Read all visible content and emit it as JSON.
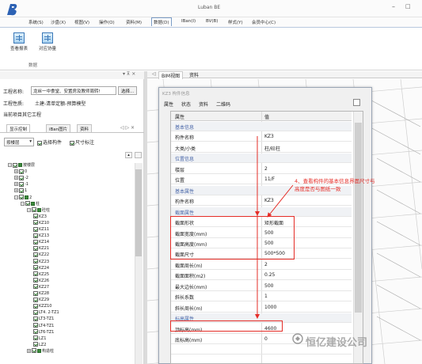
{
  "app": {
    "title": "Luban BE",
    "min_glyph": "–",
    "max_glyph": "□"
  },
  "menu": [
    {
      "label": "系统(S)"
    },
    {
      "label": "沙盘(X)"
    },
    {
      "label": "视图(V)"
    },
    {
      "label": "操作(O)"
    },
    {
      "label": "资料(M)"
    },
    {
      "label": "数据(D)",
      "active": true
    },
    {
      "label": "IBan(I)"
    },
    {
      "label": "BV(B)"
    },
    {
      "label": "样式(Y)"
    },
    {
      "label": "会员中心(C)"
    }
  ],
  "ribbon": {
    "buttons": [
      {
        "label": "查看报表"
      },
      {
        "label": "对应协量"
      }
    ],
    "group_label": "数据"
  },
  "left_panel": {
    "controls": "▾ ⊼ ×",
    "project_name_label": "工程名称:",
    "project_name_value": "龙丝一中食堂、安置房及教师周转!",
    "select_button": "选择...",
    "project_type_label": "工程性质:",
    "project_type_value": "土建-清单定额-预算模型",
    "current_project": "当前项目其它工程",
    "tabs": [
      {
        "label": "显示控制",
        "active": true
      },
      {
        "label": "iBan图片"
      },
      {
        "label": "资料"
      }
    ],
    "tab_nav": "◁ ▷ ×",
    "mode_select": "按楼层",
    "checkbox_component": "选择构件",
    "checkbox_size": "尺寸标注",
    "scroll_up": "▴",
    "tree": [
      {
        "label": "按楼层",
        "level": 0,
        "exp": "−",
        "sq": true
      },
      {
        "label": "0",
        "level": 1,
        "exp": "+"
      },
      {
        "label": "-2",
        "level": 1,
        "exp": "+"
      },
      {
        "label": "-1",
        "level": 1,
        "exp": "+"
      },
      {
        "label": "1",
        "level": 1,
        "exp": "+"
      },
      {
        "label": "2",
        "level": 1,
        "exp": "−",
        "sq": true
      },
      {
        "label": "柱",
        "level": 2,
        "exp": "−",
        "sq": true
      },
      {
        "label": "砼柱",
        "level": 3,
        "exp": "−",
        "sq": true
      },
      {
        "label": "KZ3",
        "level": 4
      },
      {
        "label": "KZ10",
        "level": 4
      },
      {
        "label": "KZ11",
        "level": 4
      },
      {
        "label": "KZ13",
        "level": 4
      },
      {
        "label": "KZ14",
        "level": 4
      },
      {
        "label": "KZ21",
        "level": 4
      },
      {
        "label": "KZ22",
        "level": 4
      },
      {
        "label": "KZ23",
        "level": 4
      },
      {
        "label": "KZ24",
        "level": 4
      },
      {
        "label": "KZ25",
        "level": 4
      },
      {
        "label": "KZ26",
        "level": 4
      },
      {
        "label": "KZ27",
        "level": 4
      },
      {
        "label": "KZ28",
        "level": 4
      },
      {
        "label": "KZ29",
        "level": 4
      },
      {
        "label": "KZZ10",
        "level": 4
      },
      {
        "label": "LT4. 2-TZ1",
        "level": 4
      },
      {
        "label": "LT3-TZ1",
        "level": 4
      },
      {
        "label": "LT4-TZ1",
        "level": 4
      },
      {
        "label": "LT6-TZ1",
        "level": 4
      },
      {
        "label": "LZ1",
        "level": 4
      },
      {
        "label": "LZ2",
        "level": 4
      },
      {
        "label": "构造柱",
        "level": 3,
        "exp": "+",
        "sq": true
      }
    ]
  },
  "view": {
    "tabs": [
      {
        "label": "BIM视图",
        "active": true
      },
      {
        "label": "资料"
      }
    ],
    "nav_left": "◁",
    "nav_right": "▷"
  },
  "dialog": {
    "title": "KZ3 构件信息",
    "tabs": [
      {
        "label": "属性"
      },
      {
        "label": "状态"
      },
      {
        "label": "资料"
      },
      {
        "label": "二维码"
      }
    ],
    "col_name": "属性",
    "col_value": "值",
    "rows": [
      {
        "name": "基本信息",
        "value": "",
        "group": true
      },
      {
        "name": "构件名称",
        "value": "KZ3"
      },
      {
        "name": "大类/小类",
        "value": "柱/砼柱"
      },
      {
        "name": "位置信息",
        "value": "",
        "group": true
      },
      {
        "name": "楼层",
        "value": "2"
      },
      {
        "name": "位置",
        "value": "11/F"
      },
      {
        "name": "基本属性",
        "value": "",
        "group": true
      },
      {
        "name": "构件名称",
        "value": "KZ3"
      },
      {
        "name": "截面属性",
        "value": "",
        "group": true
      },
      {
        "name": "截面形状",
        "value": "矩形截面"
      },
      {
        "name": "截面宽度(mm)",
        "value": "500"
      },
      {
        "name": "截面高度(mm)",
        "value": "500"
      },
      {
        "name": "截面尺寸",
        "value": "500*500"
      },
      {
        "name": "截面周长(m)",
        "value": "2"
      },
      {
        "name": "截面面积(m2)",
        "value": "0.25"
      },
      {
        "name": "最大边长(mm)",
        "value": "500"
      },
      {
        "name": "斜长系数",
        "value": "1"
      },
      {
        "name": "斜长周长(m)",
        "value": "1000"
      },
      {
        "name": "标高属性",
        "value": "",
        "group": true
      },
      {
        "name": "顶标高(mm)",
        "value": "4600"
      },
      {
        "name": "底标高(mm)",
        "value": "0"
      },
      {
        "name": "",
        "value": ""
      }
    ]
  },
  "annotation": {
    "text": "4、查看构件的基本信息界面尺寸与高度是否与图纸一致"
  },
  "watermark": {
    "text": "恒亿建设公司"
  },
  "colors": {
    "annotation_red": "#e52d27",
    "grid_green": "#3c8a3c",
    "accent_blue": "#3a78b8"
  }
}
